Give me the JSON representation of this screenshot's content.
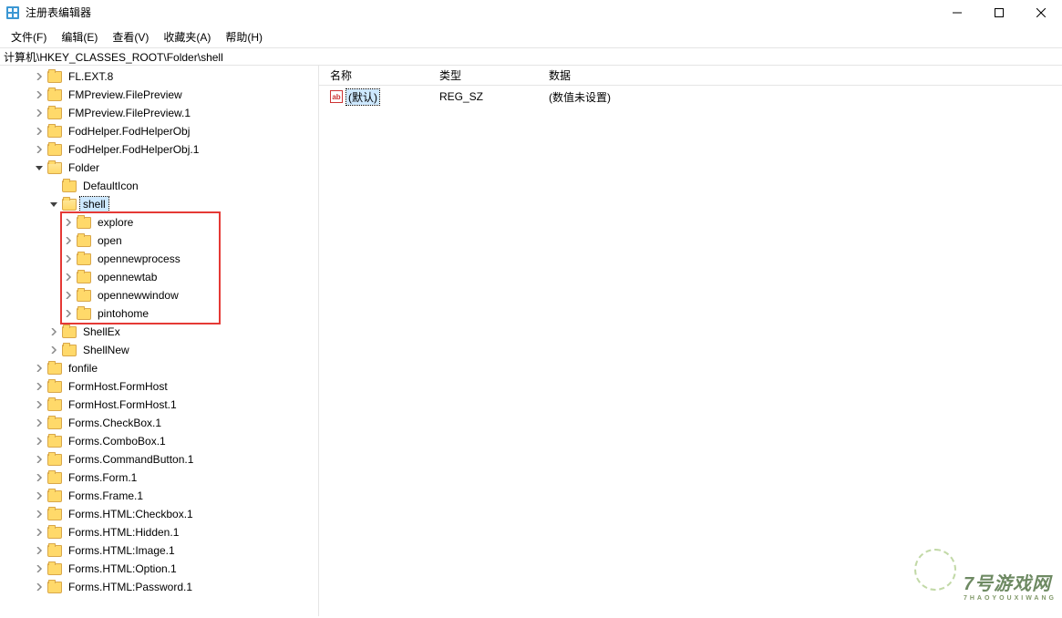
{
  "window": {
    "title": "注册表编辑器"
  },
  "menu": {
    "file": "文件(F)",
    "edit": "编辑(E)",
    "view": "查看(V)",
    "fav": "收藏夹(A)",
    "help": "帮助(H)"
  },
  "address": "计算机\\HKEY_CLASSES_ROOT\\Folder\\shell",
  "columns": {
    "name": "名称",
    "type": "类型",
    "data": "数据"
  },
  "value_row": {
    "name": "(默认)",
    "type": "REG_SZ",
    "data": "(数值未设置)"
  },
  "tree": [
    {
      "depth": 2,
      "exp": ">",
      "label": "FL.EXT.8"
    },
    {
      "depth": 2,
      "exp": ">",
      "label": "FMPreview.FilePreview"
    },
    {
      "depth": 2,
      "exp": ">",
      "label": "FMPreview.FilePreview.1"
    },
    {
      "depth": 2,
      "exp": ">",
      "label": "FodHelper.FodHelperObj"
    },
    {
      "depth": 2,
      "exp": ">",
      "label": "FodHelper.FodHelperObj.1"
    },
    {
      "depth": 2,
      "exp": "v",
      "label": "Folder",
      "open": true
    },
    {
      "depth": 3,
      "exp": "",
      "label": "DefaultIcon"
    },
    {
      "depth": 3,
      "exp": "v",
      "label": "shell",
      "open": true,
      "selected": true
    },
    {
      "depth": 4,
      "exp": ">",
      "label": "explore",
      "hl": true
    },
    {
      "depth": 4,
      "exp": ">",
      "label": "open",
      "hl": true
    },
    {
      "depth": 4,
      "exp": ">",
      "label": "opennewprocess",
      "hl": true
    },
    {
      "depth": 4,
      "exp": ">",
      "label": "opennewtab",
      "hl": true
    },
    {
      "depth": 4,
      "exp": ">",
      "label": "opennewwindow",
      "hl": true
    },
    {
      "depth": 4,
      "exp": ">",
      "label": "pintohome",
      "hl": true
    },
    {
      "depth": 3,
      "exp": ">",
      "label": "ShellEx"
    },
    {
      "depth": 3,
      "exp": ">",
      "label": "ShellNew"
    },
    {
      "depth": 2,
      "exp": ">",
      "label": "fonfile"
    },
    {
      "depth": 2,
      "exp": ">",
      "label": "FormHost.FormHost"
    },
    {
      "depth": 2,
      "exp": ">",
      "label": "FormHost.FormHost.1"
    },
    {
      "depth": 2,
      "exp": ">",
      "label": "Forms.CheckBox.1"
    },
    {
      "depth": 2,
      "exp": ">",
      "label": "Forms.ComboBox.1"
    },
    {
      "depth": 2,
      "exp": ">",
      "label": "Forms.CommandButton.1"
    },
    {
      "depth": 2,
      "exp": ">",
      "label": "Forms.Form.1"
    },
    {
      "depth": 2,
      "exp": ">",
      "label": "Forms.Frame.1"
    },
    {
      "depth": 2,
      "exp": ">",
      "label": "Forms.HTML:Checkbox.1"
    },
    {
      "depth": 2,
      "exp": ">",
      "label": "Forms.HTML:Hidden.1"
    },
    {
      "depth": 2,
      "exp": ">",
      "label": "Forms.HTML:Image.1"
    },
    {
      "depth": 2,
      "exp": ">",
      "label": "Forms.HTML:Option.1"
    },
    {
      "depth": 2,
      "exp": ">",
      "label": "Forms.HTML:Password.1"
    }
  ],
  "watermark": {
    "main": "7号游戏网",
    "sub": "7HAOYOUXIWANG"
  }
}
